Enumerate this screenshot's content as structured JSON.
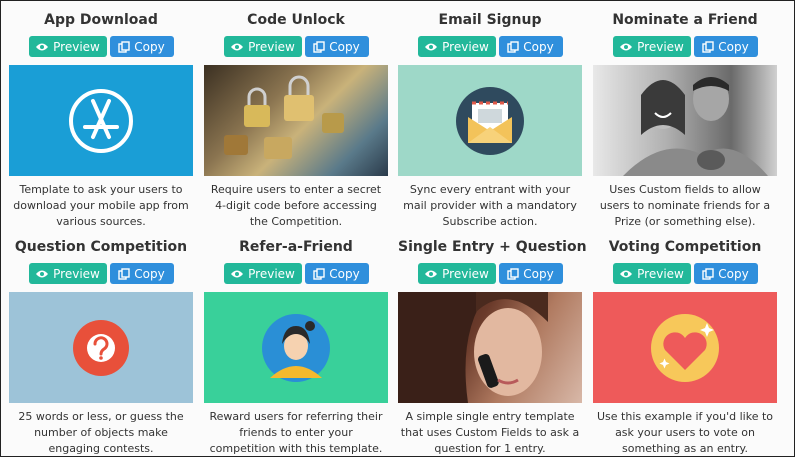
{
  "cards": [
    {
      "title": "App Download",
      "preview_label": "Preview",
      "copy_label": "Copy",
      "image": "app-store-icon",
      "color": "#1a9ed6",
      "description": "Template to ask your users to download your mobile app from various sources."
    },
    {
      "title": "Code Unlock",
      "preview_label": "Preview",
      "copy_label": "Copy",
      "image": "padlocks-photo",
      "color": "#8a7450",
      "description": "Require users to enter a secret 4-digit code before accessing the Competition."
    },
    {
      "title": "Email Signup",
      "preview_label": "Preview",
      "copy_label": "Copy",
      "image": "envelope-icon",
      "color": "#9ed8c8",
      "description": "Sync every entrant with your mail provider with a mandatory Subscribe action."
    },
    {
      "title": "Nominate a Friend",
      "preview_label": "Preview",
      "copy_label": "Copy",
      "image": "couple-photo",
      "color": "#9a9a9a",
      "description": "Uses Custom fields to allow users to nominate friends for a Prize (or something else)."
    },
    {
      "title": "Question Competition",
      "preview_label": "Preview",
      "copy_label": "Copy",
      "image": "question-mark-icon",
      "color": "#9dc3d8",
      "description": "25 words or less, or guess the number of objects make engaging contests."
    },
    {
      "title": "Refer-a-Friend",
      "preview_label": "Preview",
      "copy_label": "Copy",
      "image": "person-avatar-icon",
      "color": "#39d09a",
      "description": "Reward users for referring their friends to enter your competition with this template."
    },
    {
      "title": "Single Entry + Question",
      "preview_label": "Preview",
      "copy_label": "Copy",
      "image": "woman-phone-photo",
      "color": "#7a4a3a",
      "description": "A simple single entry template that uses Custom Fields to ask a question for 1 entry."
    },
    {
      "title": "Voting Competition",
      "preview_label": "Preview",
      "copy_label": "Copy",
      "image": "heart-icon",
      "color": "#ee5a5a",
      "description": "Use this example if you'd like to ask your users to vote on something as an entry."
    }
  ]
}
